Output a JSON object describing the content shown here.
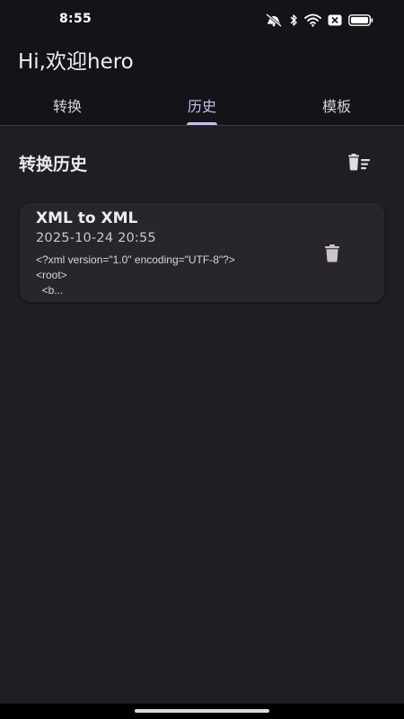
{
  "status_bar": {
    "time": "8:55",
    "icons": [
      "notifications-muted-icon",
      "bluetooth-icon",
      "wifi-icon",
      "sim-no-signal-icon",
      "battery-icon"
    ]
  },
  "header": {
    "greeting": "Hi,欢迎hero"
  },
  "tabs": [
    {
      "label": "转换",
      "active": false
    },
    {
      "label": "历史",
      "active": true
    },
    {
      "label": "模板",
      "active": false
    }
  ],
  "history": {
    "title": "转换历史",
    "clear_all_icon": "delete-sweep-icon",
    "items": [
      {
        "title": "XML to XML",
        "time": "2025-10-24 20:55",
        "preview": "<?xml version=\"1.0\" encoding=\"UTF-8\"?>\n<root>\n  <b...",
        "delete_icon": "trash-icon"
      }
    ]
  },
  "colors": {
    "accent": "#cdbdf5",
    "header_bg": "#141317",
    "body_bg": "#1f1e22",
    "card_bg": "#28262b"
  }
}
